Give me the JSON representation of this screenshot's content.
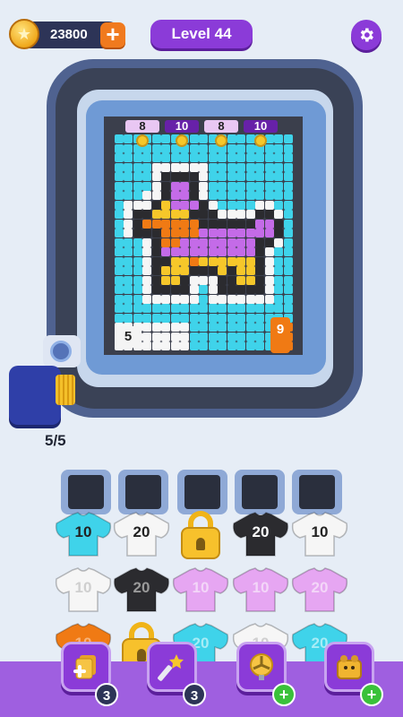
{
  "header": {
    "coins": "23800",
    "plus_label": "+",
    "level_label": "Level 44"
  },
  "board": {
    "targets": [
      {
        "count": "8",
        "dark": false
      },
      {
        "count": "10",
        "dark": true
      },
      {
        "count": "8",
        "dark": false
      },
      {
        "count": "10",
        "dark": true
      }
    ],
    "left_tag": "5",
    "right_tag": "9",
    "progress": "5/5"
  },
  "shirt_rows": [
    [
      {
        "type": "shirt",
        "color": "#3fd3ea",
        "text_color": "#222",
        "label": "10"
      },
      {
        "type": "shirt",
        "color": "#f6f6f6",
        "text_color": "#222",
        "label": "20"
      },
      {
        "type": "lock"
      },
      {
        "type": "shirt",
        "color": "#2b2b2f",
        "text_color": "#fff",
        "label": "20"
      },
      {
        "type": "shirt",
        "color": "#f6f6f6",
        "text_color": "#222",
        "label": "10"
      }
    ],
    [
      {
        "type": "shirt",
        "color": "#f6f6f6",
        "text_color": "#cfcfcf",
        "label": "10"
      },
      {
        "type": "shirt",
        "color": "#2b2b2f",
        "text_color": "#9a9a9a",
        "label": "20"
      },
      {
        "type": "shirt",
        "color": "#e6a6f2",
        "text_color": "#f3d6f8",
        "label": "10"
      },
      {
        "type": "shirt",
        "color": "#e6a6f2",
        "text_color": "#f3d6f8",
        "label": "10"
      },
      {
        "type": "shirt",
        "color": "#e6a6f2",
        "text_color": "#f3d6f8",
        "label": "20"
      }
    ],
    [
      {
        "type": "shirt",
        "color": "#f07a14",
        "text_color": "#f7b37a",
        "label": "10"
      },
      {
        "type": "lock"
      },
      {
        "type": "shirt",
        "color": "#3fd3ea",
        "text_color": "#a6ecf6",
        "label": "20"
      },
      {
        "type": "shirt",
        "color": "#f6f6f6",
        "text_color": "#cfcfcf",
        "label": "10"
      },
      {
        "type": "shirt",
        "color": "#3fd3ea",
        "text_color": "#a6ecf6",
        "label": "20"
      }
    ]
  ],
  "tools": [
    {
      "name": "add-card-tool",
      "icon": "cards-icon",
      "badge": "3",
      "green": false
    },
    {
      "name": "magic-wand-tool",
      "icon": "wand-icon",
      "badge": "3",
      "green": false
    },
    {
      "name": "fan-tool",
      "icon": "fan-icon",
      "badge": "+",
      "green": true
    },
    {
      "name": "bear-box-tool",
      "icon": "bear-box-icon",
      "badge": "+",
      "green": true
    }
  ],
  "colors": {
    "accent": "#8b3bd8",
    "cyan": "#3fd3ea",
    "white": "#f6f6f6",
    "purple": "#c46be8",
    "orange": "#f07a14",
    "yellow": "#f6c72a",
    "black": "#2b2b2f"
  }
}
